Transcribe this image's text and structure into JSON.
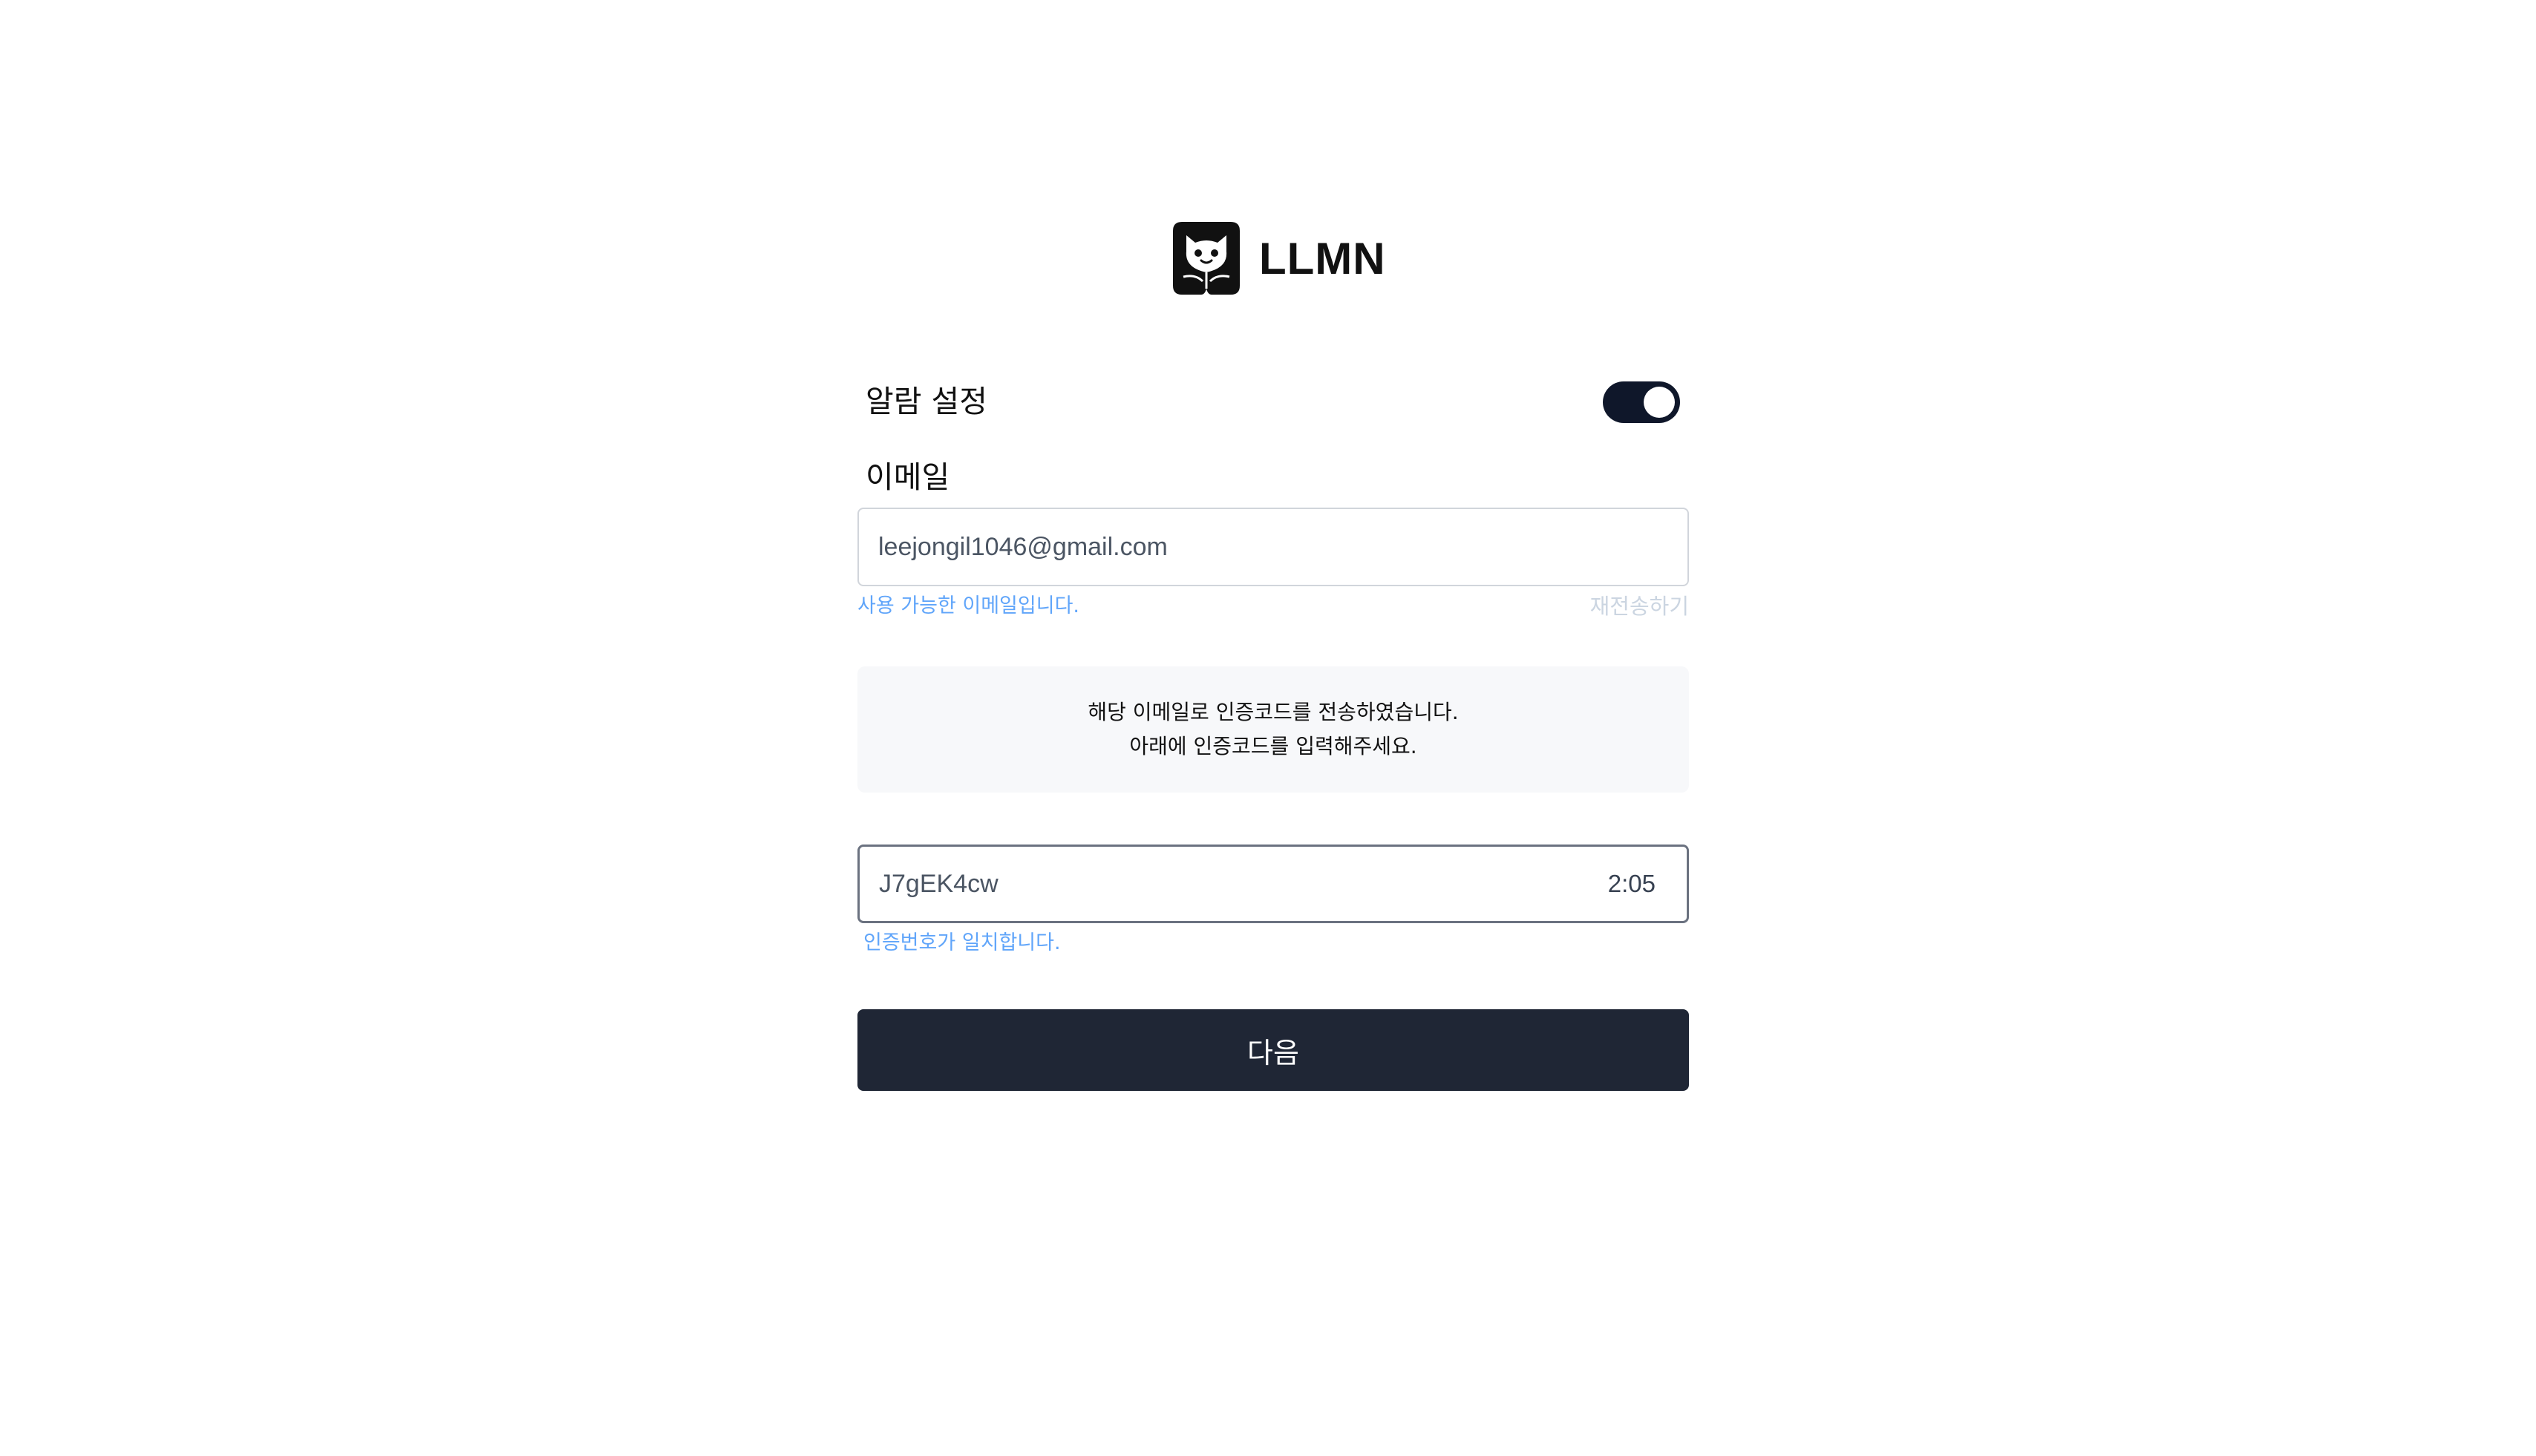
{
  "brand": {
    "name": "LLMN",
    "logo_icon": "cat-face-logo-icon"
  },
  "notification": {
    "label": "알람 설정",
    "toggle_state": "on"
  },
  "email": {
    "label": "이메일",
    "value": "leejongil1046@gmail.com",
    "status_message": "사용 가능한 이메일입니다.",
    "resend_label": "재전송하기"
  },
  "info": {
    "line1": "해당 이메일로 인증코드를 전송하였습니다.",
    "line2": "아래에 인증코드를 입력해주세요."
  },
  "verification": {
    "value": "J7gEK4cw",
    "timer": "2:05",
    "status_message": "인증번호가 일치합니다."
  },
  "next_button": {
    "label": "다음"
  },
  "colors": {
    "primary_dark": "#1f2635",
    "toggle_on": "#0f172a",
    "success_text": "#60a5fa",
    "muted_text": "#cbd5e1",
    "info_bg": "#f7f8fa"
  }
}
